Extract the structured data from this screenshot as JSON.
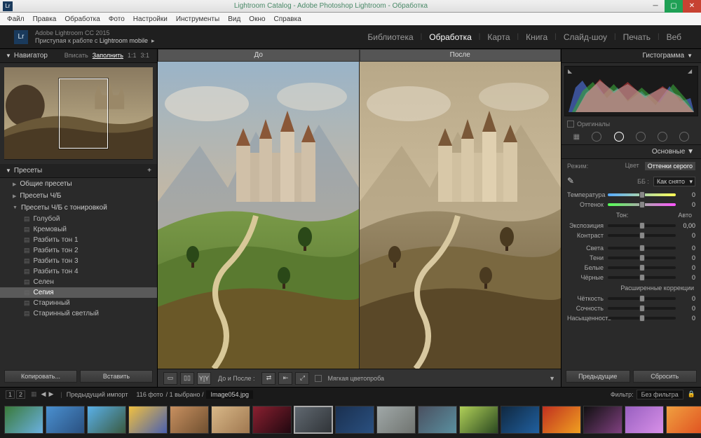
{
  "window": {
    "title": "Lightroom Catalog - Adobe Photoshop Lightroom - Обработка",
    "icon": "Lr"
  },
  "menubar": [
    "Файл",
    "Правка",
    "Обработка",
    "Фото",
    "Настройки",
    "Инструменты",
    "Вид",
    "Окно",
    "Справка"
  ],
  "header": {
    "line1": "Adobe Lightroom CC 2015",
    "line2_a": "Приступая к работе с ",
    "line2_b": "Lightroom mobile"
  },
  "modules": [
    "Библиотека",
    "Обработка",
    "Карта",
    "Книга",
    "Слайд-шоу",
    "Печать",
    "Веб"
  ],
  "module_active": 1,
  "navigator": {
    "title": "Навигатор",
    "zooms": [
      "Вписать",
      "Заполнить",
      "1:1",
      "3:1"
    ],
    "zoom_active": 1
  },
  "presets": {
    "title": "Пресеты",
    "groups_closed": [
      "Общие пресеты",
      "Пресеты Ч/Б"
    ],
    "group_open": "Пресеты Ч/Б с тонировкой",
    "items": [
      "Голубой",
      "Кремовый",
      "Разбить тон 1",
      "Разбить тон 2",
      "Разбить тон 3",
      "Разбить тон 4",
      "Селен",
      "Сепия",
      "Старинный",
      "Старинный светлый"
    ],
    "selected": 7
  },
  "left_btns": {
    "copy": "Копировать...",
    "paste": "Вставить"
  },
  "compare": {
    "before": "До",
    "after": "После"
  },
  "center_tb": {
    "mode": "До и После :",
    "softproof": "Мягкая цветопроба"
  },
  "right": {
    "histogram": "Гистограмма",
    "originals": "Оригиналы",
    "basic": "Основные",
    "treatment_label": "Режим:",
    "treatment_opts": [
      "Цвет",
      "Оттенки серого"
    ],
    "treatment_active": 1,
    "wb_label": "ББ :",
    "wb_value": "Как снято",
    "sliders_wb": [
      {
        "label": "Температура",
        "val": "0"
      },
      {
        "label": "Оттенок",
        "val": "0"
      }
    ],
    "tone_hdr": "Тон:",
    "auto": "Авто",
    "sliders_tone": [
      {
        "label": "Экспозиция",
        "val": "0,00"
      },
      {
        "label": "Контраст",
        "val": "0"
      }
    ],
    "sliders_tone2": [
      {
        "label": "Света",
        "val": "0"
      },
      {
        "label": "Тени",
        "val": "0"
      },
      {
        "label": "Белые",
        "val": "0"
      },
      {
        "label": "Чёрные",
        "val": "0"
      }
    ],
    "presence_hdr": "Расширенные коррекции",
    "sliders_presence": [
      {
        "label": "Чёткость",
        "val": "0"
      },
      {
        "label": "Сочность",
        "val": "0"
      },
      {
        "label": "Насыщенность",
        "val": "0"
      }
    ],
    "prev": "Предыдущие",
    "reset": "Сбросить"
  },
  "filmstrip_bar": {
    "nums": [
      "1",
      "2"
    ],
    "import": "Предыдущий импорт",
    "count": "116 фото",
    "sel": "/ 1 выбрано /",
    "fname": "Image054.jpg",
    "filter_label": "Фильтр:",
    "filter_value": "Без фильтра"
  },
  "thumbs": [
    {
      "c1": "#3a7a3a",
      "c2": "#6ab0e0"
    },
    {
      "c1": "#4a90d0",
      "c2": "#2a5080"
    },
    {
      "c1": "#5ab0e8",
      "c2": "#3a5a40"
    },
    {
      "c1": "#f0c040",
      "c2": "#4a60b0"
    },
    {
      "c1": "#c89060",
      "c2": "#705030"
    },
    {
      "c1": "#d8b888",
      "c2": "#a07850"
    },
    {
      "c1": "#8a2030",
      "c2": "#200810"
    },
    {
      "c1": "#606870",
      "c2": "#303438"
    },
    {
      "c1": "#1a3050",
      "c2": "#2a5080"
    },
    {
      "c1": "#a0a8a8",
      "c2": "#707470"
    },
    {
      "c1": "#4a5060",
      "c2": "#5a90a0"
    },
    {
      "c1": "#b0d058",
      "c2": "#2a4820"
    },
    {
      "c1": "#102840",
      "c2": "#2060a0"
    },
    {
      "c1": "#c03020",
      "c2": "#f0a020"
    },
    {
      "c1": "#101010",
      "c2": "#804080"
    },
    {
      "c1": "#9860c0",
      "c2": "#d890e8"
    },
    {
      "c1": "#f0a040",
      "c2": "#e05020"
    },
    {
      "c1": "#e8c830",
      "c2": "#c04020"
    }
  ],
  "thumb_selected": 7
}
